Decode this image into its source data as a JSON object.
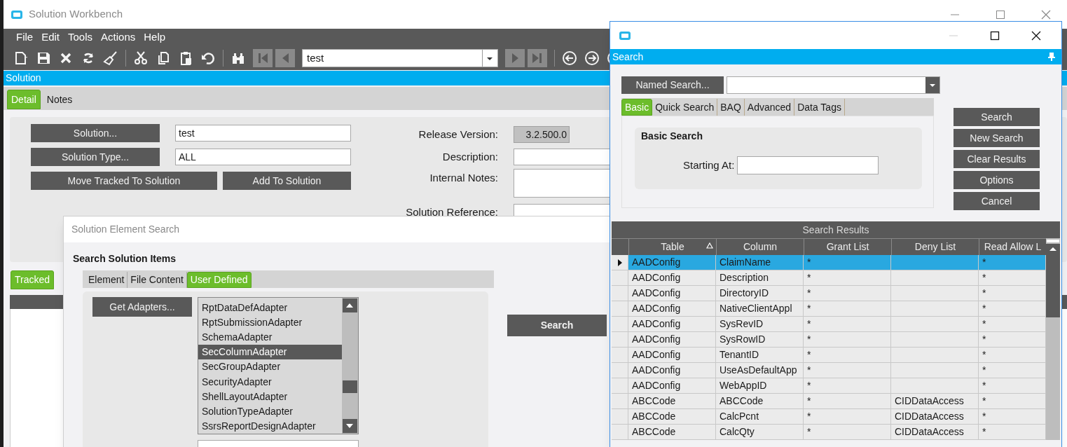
{
  "main_window": {
    "title": "Solution Workbench",
    "menu": [
      "File",
      "Edit",
      "Tools",
      "Actions",
      "Help"
    ],
    "record": "test",
    "panel_title": "Solution",
    "tabs": [
      {
        "label": "Detail",
        "selected": true
      },
      {
        "label": "Notes",
        "selected": false
      }
    ],
    "detail": {
      "solution_button": "Solution...",
      "solution_value": "test",
      "type_button": "Solution Type...",
      "type_value": "ALL",
      "move_button": "Move Tracked To Solution",
      "add_button": "Add To Solution",
      "release_label": "Release Version:",
      "release_value": "3.2.500.0",
      "description_label": "Description:",
      "notes_label": "Internal Notes:",
      "reference_label": "Solution Reference:"
    },
    "lower_tabs": [
      {
        "label": "Tracked",
        "selected": true
      }
    ]
  },
  "element_search": {
    "title": "Solution Element Search",
    "group": "Search Solution Items",
    "tabs": [
      {
        "label": "Element",
        "selected": false
      },
      {
        "label": "File Content",
        "selected": false
      },
      {
        "label": "User Defined",
        "selected": true
      }
    ],
    "get_adapters": "Get Adapters...",
    "adapters": [
      {
        "name": "RptDataDefAdapter",
        "selected": false
      },
      {
        "name": "RptSubmissionAdapter",
        "selected": false
      },
      {
        "name": "SchemaAdapter",
        "selected": false
      },
      {
        "name": "SecColumnAdapter",
        "selected": true
      },
      {
        "name": "SecGroupAdapter",
        "selected": false
      },
      {
        "name": "SecurityAdapter",
        "selected": false
      },
      {
        "name": "ShellLayoutAdapter",
        "selected": false
      },
      {
        "name": "SolutionTypeAdapter",
        "selected": false
      },
      {
        "name": "SsrsReportDesignAdapter",
        "selected": false
      }
    ],
    "search_button": "Search"
  },
  "search_dialog": {
    "panel_title": "Search",
    "named_search": "Named Search...",
    "tabs": [
      {
        "label": "Basic",
        "selected": true
      },
      {
        "label": "Quick Search",
        "selected": false
      },
      {
        "label": "BAQ",
        "selected": false
      },
      {
        "label": "Advanced",
        "selected": false
      },
      {
        "label": "Data Tags",
        "selected": false
      }
    ],
    "group": "Basic Search",
    "starting_label": "Starting At:",
    "buttons": [
      "Search",
      "New Search",
      "Clear Results",
      "Options",
      "Cancel"
    ],
    "results": {
      "title": "Search Results",
      "columns": [
        {
          "label": "Table",
          "sorted": true
        },
        {
          "label": "Column",
          "sorted": false
        },
        {
          "label": "Grant List",
          "sorted": false
        },
        {
          "label": "Deny List",
          "sorted": false
        },
        {
          "label": "Read Allow L",
          "sorted": false
        }
      ],
      "rows": [
        {
          "selected": true,
          "cells": [
            "AADConfig",
            "ClaimName",
            "*",
            "",
            "*"
          ]
        },
        {
          "selected": false,
          "cells": [
            "AADConfig",
            "Description",
            "*",
            "",
            "*"
          ]
        },
        {
          "selected": false,
          "cells": [
            "AADConfig",
            "DirectoryID",
            "*",
            "",
            "*"
          ]
        },
        {
          "selected": false,
          "cells": [
            "AADConfig",
            "NativeClientAppl",
            "*",
            "",
            "*"
          ]
        },
        {
          "selected": false,
          "cells": [
            "AADConfig",
            "SysRevID",
            "*",
            "",
            "*"
          ]
        },
        {
          "selected": false,
          "cells": [
            "AADConfig",
            "SysRowID",
            "*",
            "",
            "*"
          ]
        },
        {
          "selected": false,
          "cells": [
            "AADConfig",
            "TenantID",
            "*",
            "",
            "*"
          ]
        },
        {
          "selected": false,
          "cells": [
            "AADConfig",
            "UseAsDefaultApp",
            "*",
            "",
            "*"
          ]
        },
        {
          "selected": false,
          "cells": [
            "AADConfig",
            "WebAppID",
            "*",
            "",
            "*"
          ]
        },
        {
          "selected": false,
          "cells": [
            "ABCCode",
            "ABCCode",
            "*",
            "CIDDataAccess",
            "*"
          ]
        },
        {
          "selected": false,
          "cells": [
            "ABCCode",
            "CalcPcnt",
            "*",
            "CIDDataAccess",
            "*"
          ]
        },
        {
          "selected": false,
          "cells": [
            "ABCCode",
            "CalcQty",
            "*",
            "CIDDataAccess",
            "*"
          ]
        }
      ]
    }
  }
}
